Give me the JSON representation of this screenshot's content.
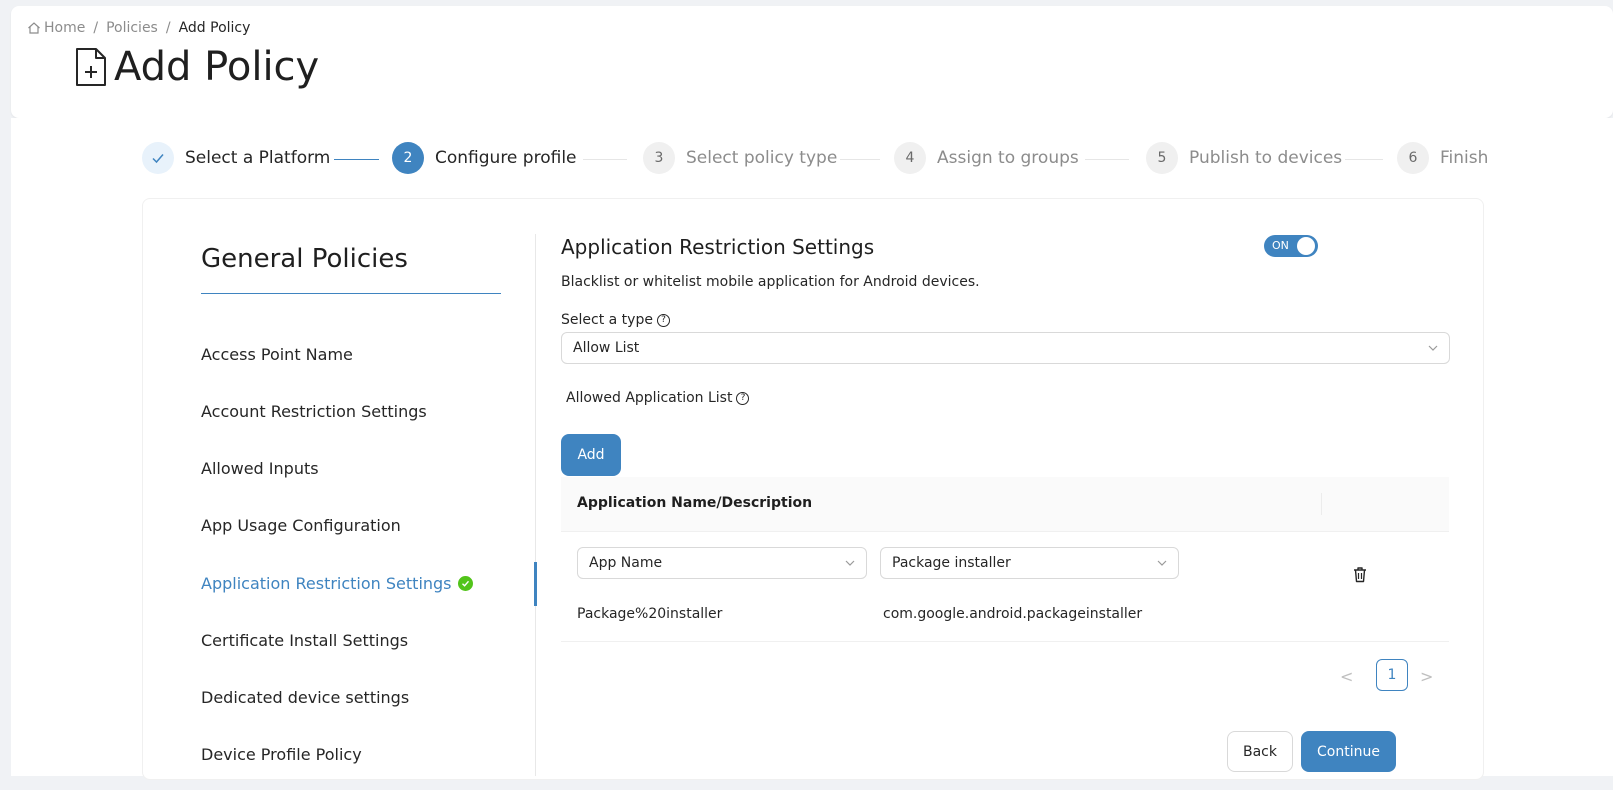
{
  "breadcrumb": {
    "home": "Home",
    "policies": "Policies",
    "current": "Add Policy",
    "separator": "/"
  },
  "page": {
    "title": "Add Policy"
  },
  "steps": [
    {
      "label": "Select a Platform",
      "number": "",
      "state": "done"
    },
    {
      "label": "Configure profile",
      "number": "2",
      "state": "active"
    },
    {
      "label": "Select policy type",
      "number": "3",
      "state": "pending"
    },
    {
      "label": "Assign to groups",
      "number": "4",
      "state": "pending"
    },
    {
      "label": "Publish to devices",
      "number": "5",
      "state": "pending"
    },
    {
      "label": "Finish",
      "number": "6",
      "state": "pending"
    }
  ],
  "sidebar": {
    "title": "General Policies",
    "items": [
      {
        "label": "Access Point Name"
      },
      {
        "label": "Account Restriction Settings"
      },
      {
        "label": "Allowed Inputs"
      },
      {
        "label": "App Usage Configuration"
      },
      {
        "label": "Application Restriction Settings",
        "selected": true
      },
      {
        "label": "Certificate Install Settings"
      },
      {
        "label": "Dedicated device settings"
      },
      {
        "label": "Device Profile Policy"
      }
    ]
  },
  "section": {
    "title": "Application Restriction Settings",
    "toggle": "ON",
    "description": "Blacklist or whitelist mobile application for Android devices.",
    "type_label": "Select a type",
    "type_value": "Allow List",
    "list_label": "Allowed Application List",
    "add_label": "Add",
    "table": {
      "header": "Application Name/Description",
      "row": {
        "name_select": "App Name",
        "package_select": "Package installer",
        "name": "Package%20installer",
        "package": "com.google.android.packageinstaller"
      }
    },
    "pager": {
      "prev": "<",
      "page": "1",
      "next": ">"
    }
  },
  "actions": {
    "back": "Back",
    "continue": "Continue"
  },
  "colors": {
    "primary": "#3f84c0",
    "success": "#52c41a"
  }
}
